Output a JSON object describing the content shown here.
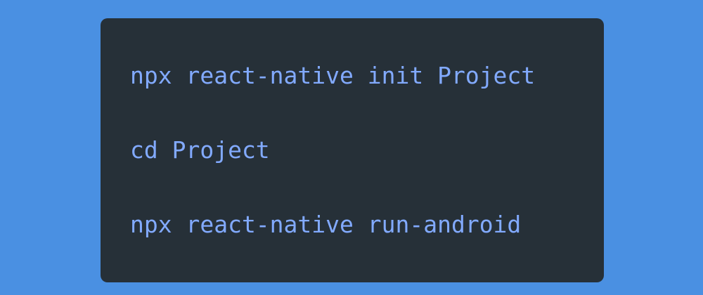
{
  "code_block": {
    "lines": [
      "npx react-native init Project",
      "cd Project",
      "npx react-native run-android"
    ]
  },
  "colors": {
    "page_background": "#4a90e2",
    "card_background": "#263038",
    "code_text": "#82aaff"
  }
}
